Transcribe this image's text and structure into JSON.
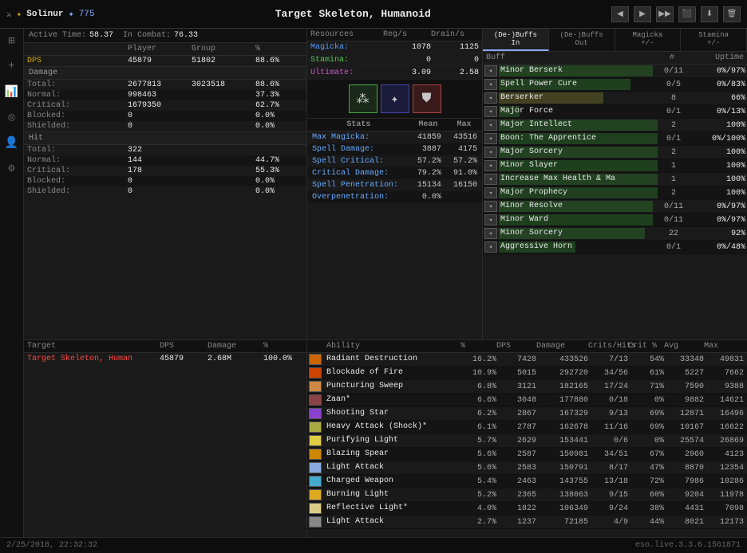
{
  "topbar": {
    "character": "Solinur",
    "cp": "775",
    "target": "Target Skeleton, Humanoid",
    "icon_char": "⚔",
    "icon_cp": "✦"
  },
  "activetime": {
    "label": "Active Time:",
    "value": "58.37",
    "incombat_label": "In Combat:",
    "incombat_value": "76.33"
  },
  "playerstats": {
    "header": [
      "",
      "Player",
      "Group",
      "%"
    ],
    "dps_label": "DPS",
    "dps_player": "45879",
    "dps_group": "51802",
    "dps_pct": "88.6%"
  },
  "damage": {
    "section": "Damage",
    "rows": [
      {
        "label": "Total:",
        "player": "2677813",
        "group": "3023518",
        "pct": "88.6%"
      },
      {
        "label": "Normal:",
        "player": "998463",
        "group": "",
        "pct": "37.3%"
      },
      {
        "label": "Critical:",
        "player": "1679350",
        "group": "",
        "pct": "62.7%"
      },
      {
        "label": "Blocked:",
        "player": "0",
        "group": "",
        "pct": "0.0%"
      },
      {
        "label": "Shielded:",
        "player": "0",
        "group": "",
        "pct": "0.0%"
      }
    ]
  },
  "hit": {
    "section": "Hit",
    "rows": [
      {
        "label": "Total:",
        "player": "322",
        "group": "",
        "pct": ""
      },
      {
        "label": "Normal:",
        "player": "144",
        "group": "",
        "pct": "44.7%"
      },
      {
        "label": "Critical:",
        "player": "178",
        "group": "",
        "pct": "55.3%"
      },
      {
        "label": "Blocked:",
        "player": "0",
        "group": "",
        "pct": "0.0%"
      },
      {
        "label": "Shielded:",
        "player": "0",
        "group": "",
        "pct": "0.0%"
      }
    ]
  },
  "resources": {
    "header": [
      "Resources",
      "Reg/s",
      "Drain/s"
    ],
    "rows": [
      {
        "label": "Magicka:",
        "reg": "1078",
        "drain": "1125"
      },
      {
        "label": "Stamina:",
        "reg": "0",
        "drain": "0"
      },
      {
        "label": "Ultimate:",
        "reg": "3.09",
        "drain": "2.58"
      }
    ]
  },
  "spellstats": {
    "header": [
      "Stats",
      "Mean",
      "Max"
    ],
    "rows": [
      {
        "label": "Max Magicka:",
        "mean": "41859",
        "max": "43516"
      },
      {
        "label": "Spell Damage:",
        "mean": "3887",
        "max": "4175"
      },
      {
        "label": "Spell Critical:",
        "mean": "57.2%",
        "max": "57.2%"
      },
      {
        "label": "Critical Damage:",
        "mean": "79.2%",
        "max": "91.0%"
      },
      {
        "label": "Spell Penetration:",
        "mean": "15134",
        "max": "16150"
      },
      {
        "label": "Overpenetration:",
        "mean": "0.0%",
        "max": ""
      }
    ]
  },
  "bufftabs": [
    {
      "label": "(De-)Buffs\nIn",
      "active": true
    },
    {
      "label": "(De-)Buffs\nOut",
      "active": false
    },
    {
      "label": "Magicka\n+/-",
      "active": false
    },
    {
      "label": "Stamina\n+/-",
      "active": false
    }
  ],
  "buffs": [
    {
      "name": "Minor Berserk",
      "count": "0/11",
      "uptime": "0%/97%",
      "pct": 97,
      "color": "#2a6a2a"
    },
    {
      "name": "Spell Power Cure",
      "count": "0/5",
      "uptime": "0%/83%",
      "pct": 83,
      "color": "#2a6a2a"
    },
    {
      "name": "Berserker",
      "count": "8",
      "uptime": "66%",
      "pct": 66,
      "color": "#6a6a2a"
    },
    {
      "name": "Major Force",
      "count": "0/1",
      "uptime": "0%/13%",
      "pct": 13,
      "color": "#2a6a2a"
    },
    {
      "name": "Major Intellect",
      "count": "2",
      "uptime": "100%",
      "pct": 100,
      "color": "#2a6a2a"
    },
    {
      "name": "Boon: The Apprentice",
      "count": "0/1",
      "uptime": "0%/100%",
      "pct": 100,
      "color": "#2a6a2a"
    },
    {
      "name": "Major Sorcery",
      "count": "2",
      "uptime": "100%",
      "pct": 100,
      "color": "#2a6a2a"
    },
    {
      "name": "Minor Slayer",
      "count": "1",
      "uptime": "100%",
      "pct": 100,
      "color": "#2a6a2a"
    },
    {
      "name": "Increase Max Health & Ma",
      "count": "1",
      "uptime": "100%",
      "pct": 100,
      "color": "#2a6a2a"
    },
    {
      "name": "Major Prophecy",
      "count": "2",
      "uptime": "100%",
      "pct": 100,
      "color": "#2a6a2a"
    },
    {
      "name": "Minor Resolve",
      "count": "0/11",
      "uptime": "0%/97%",
      "pct": 97,
      "color": "#2a6a2a"
    },
    {
      "name": "Minor Ward",
      "count": "0/11",
      "uptime": "0%/97%",
      "pct": 97,
      "color": "#2a6a2a"
    },
    {
      "name": "Minor Sorcery",
      "count": "22",
      "uptime": "92%",
      "pct": 92,
      "color": "#2a6a2a"
    },
    {
      "name": "Aggressive Horn",
      "count": "0/1",
      "uptime": "0%/48%",
      "pct": 48,
      "color": "#2a6a2a"
    }
  ],
  "targets": {
    "header": [
      "Target",
      "DPS",
      "Damage",
      "%"
    ],
    "rows": [
      {
        "name": "Target Skeleton, Human",
        "dps": "45879",
        "damage": "2.68M",
        "pct": "100.0%"
      }
    ]
  },
  "abilities": {
    "header": [
      "",
      "Ability",
      "%",
      "DPS",
      "Damage",
      "Crits/Hits",
      "Crit %",
      "Avg",
      "Max"
    ],
    "rows": [
      {
        "name": "Radiant Destruction",
        "pct": "16.2%",
        "dps": "7428",
        "damage": "433526",
        "crits": "7/13",
        "critpct": "54%",
        "avg": "33348",
        "max": "49831",
        "color": "#cc6600"
      },
      {
        "name": "Blockade of Fire",
        "pct": "10.9%",
        "dps": "5015",
        "damage": "292720",
        "crits": "34/56",
        "critpct": "61%",
        "avg": "5227",
        "max": "7662",
        "color": "#cc4400"
      },
      {
        "name": "Puncturing Sweep",
        "pct": "6.8%",
        "dps": "3121",
        "damage": "182165",
        "crits": "17/24",
        "critpct": "71%",
        "avg": "7590",
        "max": "9388",
        "color": "#cc8844"
      },
      {
        "name": "Zaan*",
        "pct": "6.6%",
        "dps": "3048",
        "damage": "177880",
        "crits": "0/18",
        "critpct": "0%",
        "avg": "9882",
        "max": "14621",
        "color": "#884444"
      },
      {
        "name": "Shooting Star",
        "pct": "6.2%",
        "dps": "2867",
        "damage": "167329",
        "crits": "9/13",
        "critpct": "69%",
        "avg": "12871",
        "max": "16496",
        "color": "#8844cc"
      },
      {
        "name": "Heavy Attack (Shock)*",
        "pct": "6.1%",
        "dps": "2787",
        "damage": "162678",
        "crits": "11/16",
        "critpct": "69%",
        "avg": "10167",
        "max": "16622",
        "color": "#aaaa44"
      },
      {
        "name": "Purifying Light",
        "pct": "5.7%",
        "dps": "2629",
        "damage": "153441",
        "crits": "0/6",
        "critpct": "0%",
        "avg": "25574",
        "max": "26869",
        "color": "#ddcc44"
      },
      {
        "name": "Blazing Spear",
        "pct": "5.6%",
        "dps": "2587",
        "damage": "150981",
        "crits": "34/51",
        "critpct": "67%",
        "avg": "2960",
        "max": "4123",
        "color": "#cc8800"
      },
      {
        "name": "Light Attack",
        "pct": "5.6%",
        "dps": "2583",
        "damage": "150791",
        "crits": "8/17",
        "critpct": "47%",
        "avg": "8870",
        "max": "12354",
        "color": "#88aadd"
      },
      {
        "name": "Charged Weapon",
        "pct": "5.4%",
        "dps": "2463",
        "damage": "143755",
        "crits": "13/18",
        "critpct": "72%",
        "avg": "7986",
        "max": "10286",
        "color": "#44aacc"
      },
      {
        "name": "Burning Light",
        "pct": "5.2%",
        "dps": "2365",
        "damage": "138063",
        "crits": "9/15",
        "critpct": "60%",
        "avg": "9204",
        "max": "11978",
        "color": "#ddaa22"
      },
      {
        "name": "Reflective Light*",
        "pct": "4.0%",
        "dps": "1822",
        "damage": "106349",
        "crits": "9/24",
        "critpct": "38%",
        "avg": "4431",
        "max": "7098",
        "color": "#ddcc88"
      },
      {
        "name": "Light Attack",
        "pct": "2.7%",
        "dps": "1237",
        "damage": "72185",
        "crits": "4/9",
        "critpct": "44%",
        "avg": "8021",
        "max": "12173",
        "color": "#888888"
      }
    ]
  },
  "statusbar": {
    "timestamp": "2/25/2018, 22:32:32",
    "version": "eso.live.3.3.6.1561871"
  }
}
